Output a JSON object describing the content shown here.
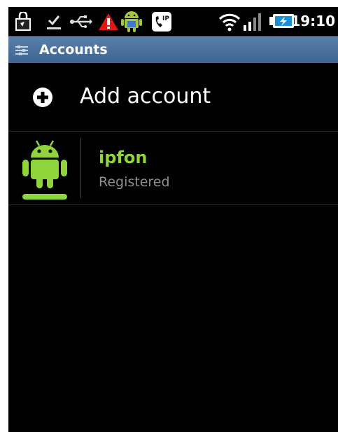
{
  "status_bar": {
    "time": "19:10",
    "icons": [
      "shopping-bag-icon",
      "download-done-icon",
      "usb-icon",
      "warning-icon",
      "android-icon",
      "sip-call-icon",
      "wifi-icon",
      "signal-icon",
      "battery-charging-icon"
    ],
    "sip_label": "IP"
  },
  "title_bar": {
    "title": "Accounts"
  },
  "add_account": {
    "label": "Add account",
    "icon": "add-circle-icon"
  },
  "accounts": [
    {
      "name": "ipfon",
      "status": "Registered",
      "icon": "android-robot-icon"
    }
  ],
  "colors": {
    "accent_green": "#8ed43a",
    "title_bar": "#4a6f9c",
    "secondary_text": "#8f8f8f"
  }
}
